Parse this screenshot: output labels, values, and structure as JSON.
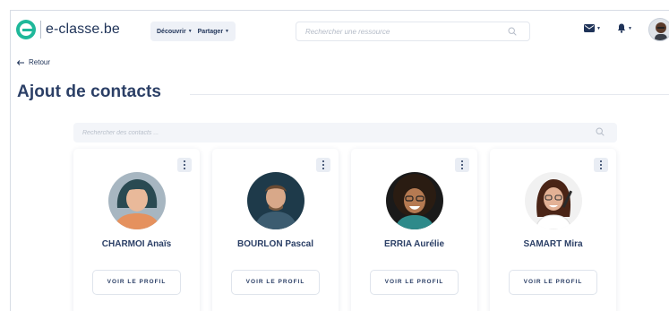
{
  "header": {
    "logo_text": "e-classe.be",
    "nav": [
      {
        "label": "Découvrir"
      },
      {
        "label": "Partager"
      }
    ],
    "search_placeholder": "Rechercher une ressource",
    "icons": [
      "mail-icon",
      "bell-icon",
      "search-icon"
    ]
  },
  "back_label": "Retour",
  "page_title": "Ajout de contacts",
  "contacts_search_placeholder": "Rechercher des contacts ...",
  "contacts": [
    {
      "name": "CHARMOI Anaïs",
      "button": "VOIR LE PROFIL"
    },
    {
      "name": "BOURLON Pascal",
      "button": "VOIR LE PROFIL"
    },
    {
      "name": "ERRIA Aurélie",
      "button": "VOIR LE PROFIL"
    },
    {
      "name": "SAMART Mira",
      "button": "VOIR LE PROFIL"
    }
  ],
  "colors": {
    "brand": "#1fb89a",
    "text_primary": "#2b3f66",
    "nav_bg": "#eef1f7"
  }
}
